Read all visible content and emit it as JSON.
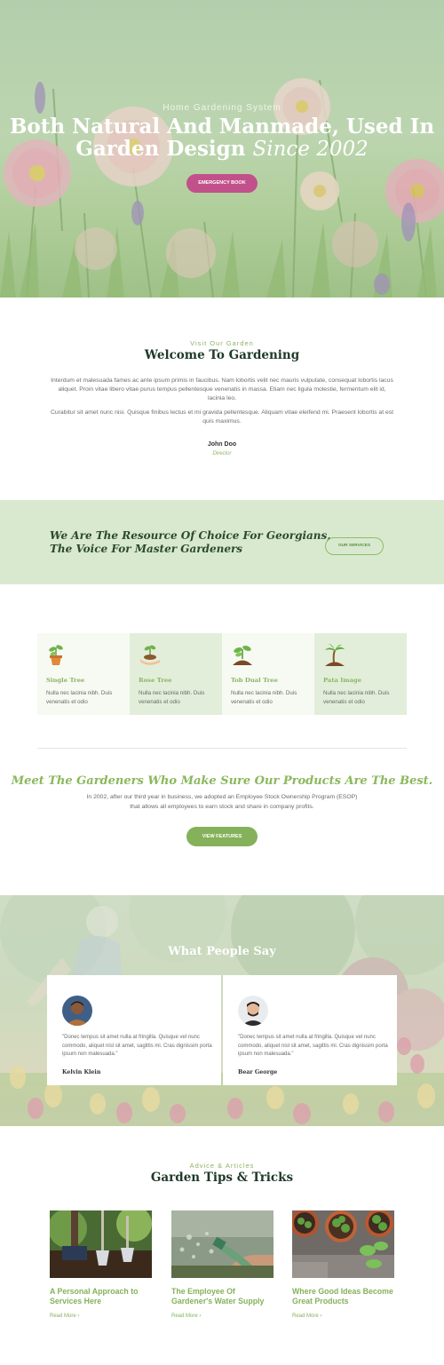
{
  "hero": {
    "subtitle": "Home Gardening System",
    "title_line1": "Both Natural And Manmade, Used In",
    "title_line2_main": "Garden Design",
    "title_line2_italic": "Since 2002",
    "button_label": "EMERGENCY BOOK"
  },
  "welcome": {
    "kicker": "Visit Our Garden",
    "title": "Welcome To Gardening",
    "paragraph1": "Interdum et malesuada fames ac ante ipsum primis in faucibus. Nam lobortis velit nec mauris vulputate, consequat lobortis lacus aliquet. Proin vitae libero vitae purus tempus pellentesque venenatis in massa. Etiam nec ligula molestie, fermentum elit id, lacinia leo.",
    "paragraph2": "Curabitur sit amet nunc nisi. Quisque finibus lectus et mi gravida pellentesque. Aliquam vitae eleifend mi. Praesent lobortis at est quis maximus.",
    "signer_name": "John Doo",
    "signer_role": "Director"
  },
  "band": {
    "line1": "We Are The Resource Of Choice For Georgians,",
    "line2": "The Voice For Master Gardeners",
    "button_label": "OUR SERVICES"
  },
  "features": [
    {
      "title": "Single Tree",
      "text": "Nulla nec lacinia nibh. Duis venenatis et odio",
      "icon": "potted-sprout-icon",
      "bg": "#f6faf2"
    },
    {
      "title": "Rose Tree",
      "text": "Nulla nec lacinia nibh. Duis venenatis et odio",
      "icon": "hand-seedling-icon",
      "bg": "#e2eed9"
    },
    {
      "title": "Tob Dual Tree",
      "text": "Nulla nec lacinia nibh. Duis venenatis et odio",
      "icon": "soil-sprout-icon",
      "bg": "#f6faf2"
    },
    {
      "title": "Pata Image",
      "text": "Nulla nec lacinia nibh. Duis venenatis et odio",
      "icon": "palm-tree-icon",
      "bg": "#e2eed9"
    }
  ],
  "meet": {
    "title": "Meet The Gardeners Who Make Sure Our Products Are The Best.",
    "text_line1": "In 2002, after our third year in business, we adopted an Employee Stock Ownership Program (ESOP)",
    "text_line2": "that allows all employees to earn stock and share in company profits.",
    "button_label": "VIEW FEATURES"
  },
  "testimonials": {
    "title": "What People Say",
    "items": [
      {
        "quote": "\"Donec tempus sit amet nulla at fringilla. Quisque vel nunc commodo, aliquet nisl sit amet, sagittis mi. Cras dignissim porta ipsum non malesuada.\"",
        "name": "Kelvin Klein"
      },
      {
        "quote": "\"Donec tempus sit amet nulla at fringilla. Quisque vel nunc commodo, aliquet nisl sit amet, sagittis mi. Cras dignissim porta ipsum non malesuada.\"",
        "name": "Bear George"
      }
    ]
  },
  "tips": {
    "kicker": "Advice & Articles",
    "title": "Garden Tips & Tricks",
    "read_more": "Read More",
    "read_more_arrow": "›",
    "items": [
      {
        "title": "A Personal Approach to Services Here"
      },
      {
        "title": "The Employee Of Gardener's Water Supply"
      },
      {
        "title": "Where Good Ideas Become Great Products"
      }
    ]
  },
  "colors": {
    "accent_green": "#85b15a",
    "dark_green": "#1f3a28",
    "emergency_pink": "#c2508a",
    "band_bg": "#d9e9cf"
  }
}
